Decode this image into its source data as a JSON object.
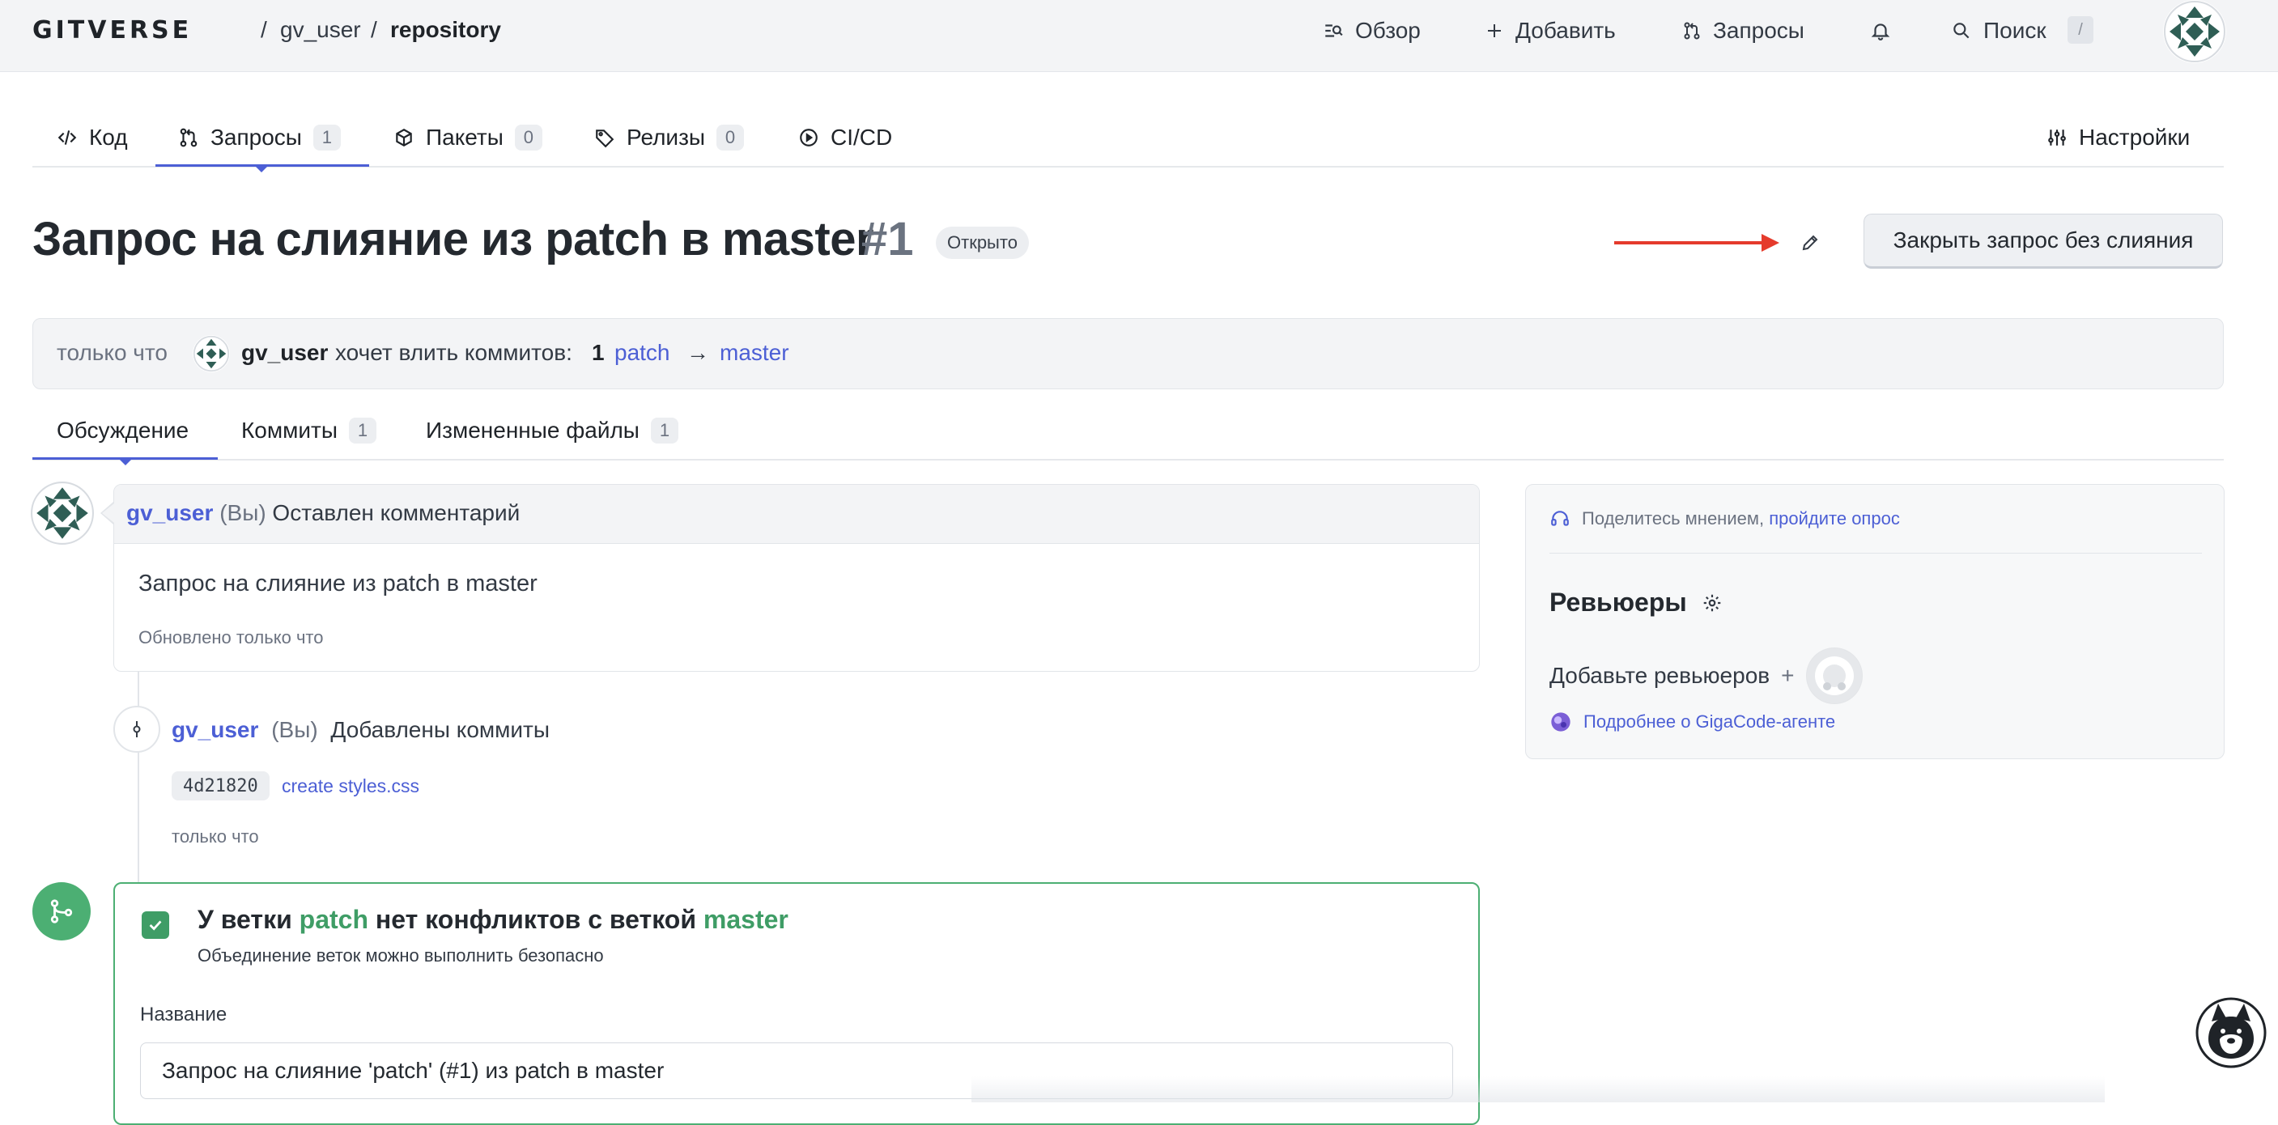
{
  "header": {
    "logo": "GITVERSE",
    "breadcrumb": {
      "sep": "/",
      "owner": "gv_user",
      "repo": "repository"
    },
    "nav": [
      {
        "label": "Обзор",
        "icon": "overview-icon"
      },
      {
        "label": "Добавить",
        "icon": "plus-icon"
      },
      {
        "label": "Запросы",
        "icon": "pull-request-icon"
      }
    ],
    "search_label": "Поиск",
    "search_shortcut": "/"
  },
  "repo_tabs": [
    {
      "label": "Код",
      "icon": "code-icon"
    },
    {
      "label": "Запросы",
      "count": "1",
      "icon": "pull-request-icon",
      "active": true
    },
    {
      "label": "Пакеты",
      "count": "0",
      "icon": "package-icon"
    },
    {
      "label": "Релизы",
      "count": "0",
      "icon": "tag-icon"
    },
    {
      "label": "CI/CD",
      "icon": "play-circle-icon"
    }
  ],
  "settings_label": "Настройки",
  "pr": {
    "title": "Запрос на слияние из patch в master",
    "number": "#1",
    "status": "Открыто",
    "close_button": "Закрыть запрос без слияния"
  },
  "info": {
    "time": "только что",
    "user": "gv_user",
    "action": "хочет влить коммитов:",
    "commit_count": "1",
    "source_branch": "patch",
    "arrow": "→",
    "target_branch": "master"
  },
  "pr_tabs": [
    {
      "label": "Обсуждение",
      "active": true
    },
    {
      "label": "Коммиты",
      "count": "1"
    },
    {
      "label": "Измененные файлы",
      "count": "1"
    }
  ],
  "comment": {
    "user": "gv_user",
    "you": "(Вы)",
    "action": "Оставлен комментарий",
    "body": "Запрос на слияние из patch в master",
    "updated": "Обновлено только что"
  },
  "commit_event": {
    "user": "gv_user",
    "you": "(Вы)",
    "action": "Добавлены коммиты",
    "sha": "4d21820",
    "message": "create styles.css",
    "time": "только что"
  },
  "merge": {
    "title_prefix": "У ветки",
    "source_branch": "patch",
    "title_middle": "нет конфликтов с веткой",
    "target_branch": "master",
    "subtitle": "Объединение веток можно выполнить безопасно",
    "name_label": "Название",
    "name_value": "Запрос на слияние 'patch' (#1) из patch в master"
  },
  "sidebar": {
    "poll_text": "Поделитесь мнением,",
    "poll_link": "пройдите опрос",
    "reviewers_title": "Ревьюеры",
    "add_reviewers": "Добавьте ревьюеров",
    "add_symbol": "+",
    "giga_link": "Подробнее о GigaCode-агенте"
  },
  "colors": {
    "accent": "#4c5fd5",
    "success": "#4caf73",
    "annotation_arrow": "#e53b2c"
  }
}
